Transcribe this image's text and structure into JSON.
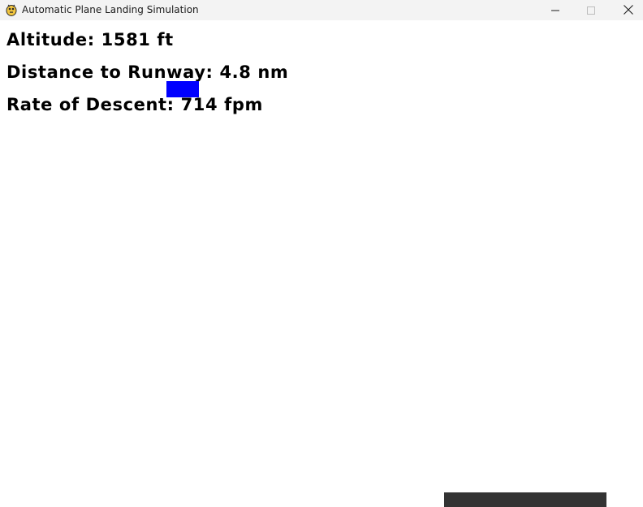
{
  "window": {
    "title": "Automatic Plane Landing Simulation",
    "icon": "pygame-snake-icon",
    "controls": {
      "minimize_icon": "minimize-icon",
      "maximize_icon": "maximize-icon",
      "close_icon": "close-icon"
    }
  },
  "hud": {
    "altitude_label": "Altitude: ",
    "altitude_value": "1581 ft",
    "distance_label": "Distance to Runway: ",
    "distance_value": "4.8 nm",
    "rate_label": "Rate of Descent: ",
    "rate_value": "714 fpm"
  },
  "scene": {
    "plane_color": "#0000ff",
    "runway_color": "#333333",
    "background_color": "#ffffff"
  }
}
